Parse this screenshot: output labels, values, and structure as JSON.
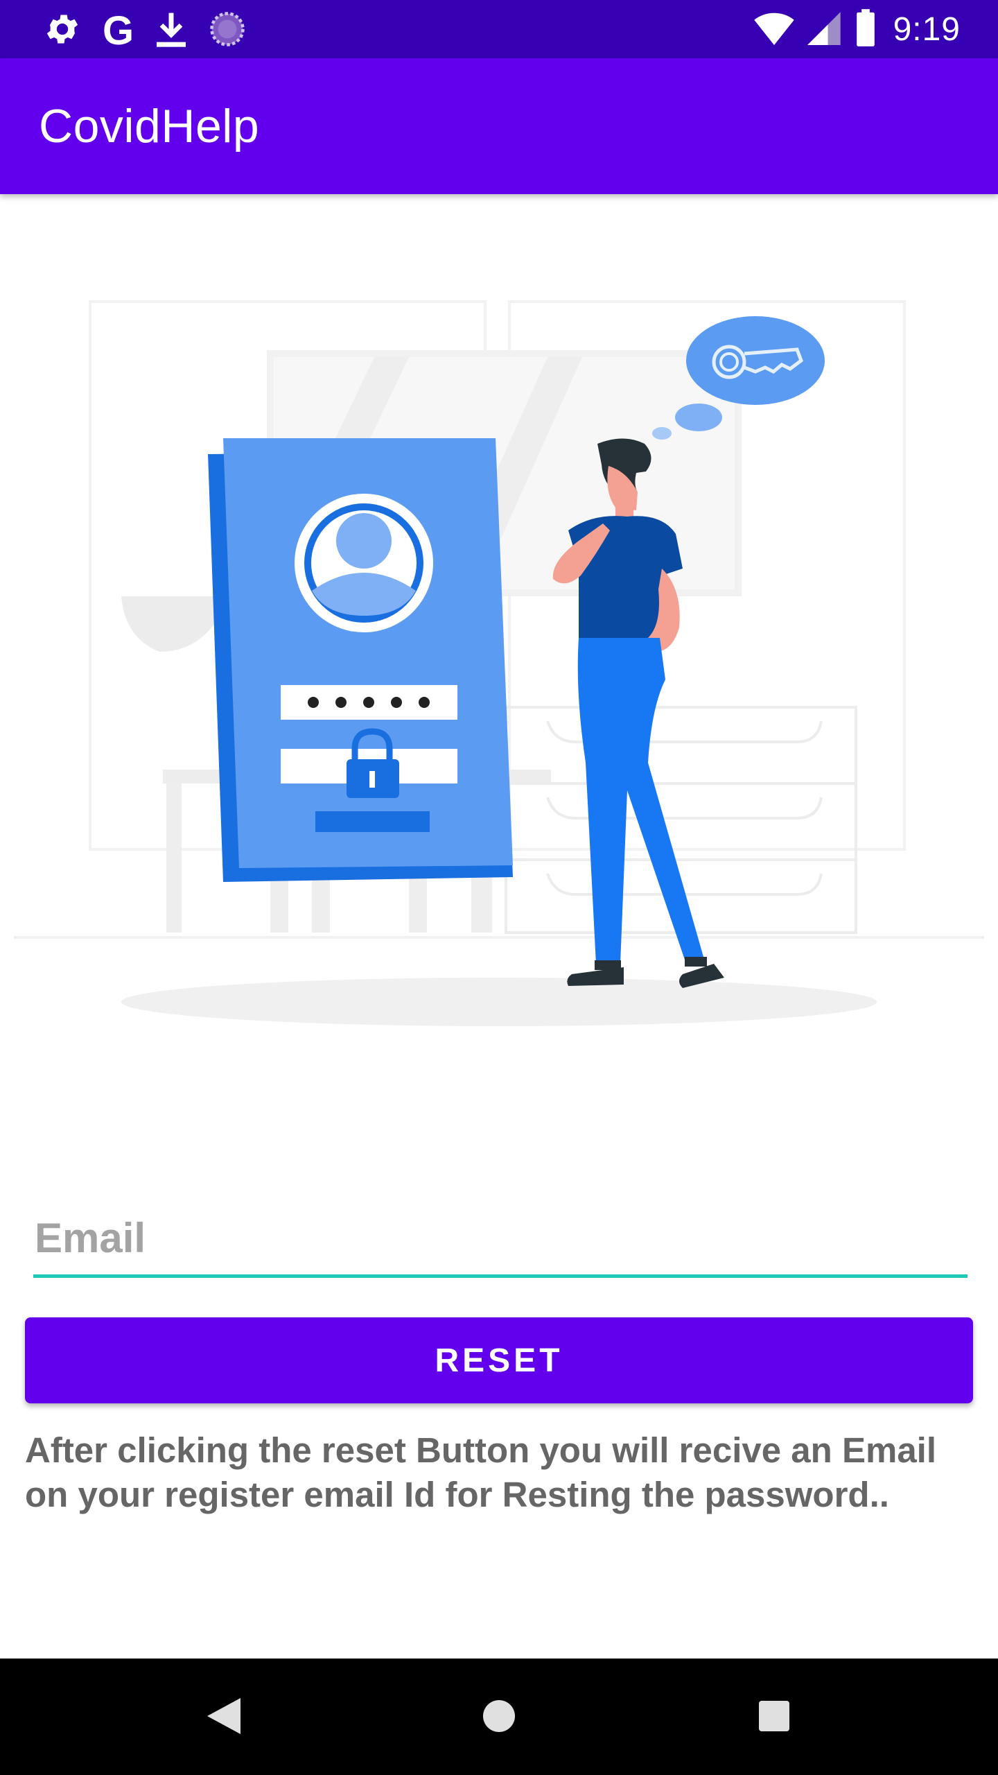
{
  "status_bar": {
    "time": "9:19",
    "left_icons": [
      "settings-icon",
      "google-icon",
      "download-icon",
      "sync-icon"
    ],
    "right_icons": [
      "wifi-icon",
      "signal-icon",
      "battery-icon"
    ]
  },
  "app_bar": {
    "title": "CovidHelp"
  },
  "illustration": {
    "subject": "forgot-password-illustration"
  },
  "form": {
    "email_placeholder": "Email",
    "email_value": "",
    "reset_label": "RESET",
    "info_text": "After clicking the reset Button you will recive an Email on your register email Id for Resting the password.."
  },
  "nav_bar": {
    "buttons": [
      "back-icon",
      "home-icon",
      "recents-icon"
    ]
  },
  "colors": {
    "status_bar": "#3700b3",
    "primary": "#6200ee",
    "accent_underline": "#1ec8b5",
    "illustration_blue": "#5b9cf2",
    "illustration_dark_blue": "#0a4aa1",
    "text_gray": "#666666"
  }
}
